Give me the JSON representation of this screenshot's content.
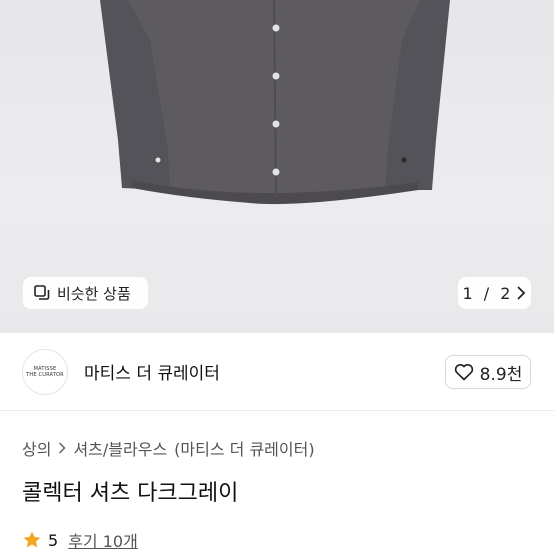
{
  "gallery": {
    "similar_label": "비슷한 상품",
    "page_current": "1",
    "page_total": "2",
    "page_sep": " / "
  },
  "shop": {
    "logo_line1": "MATISSE",
    "logo_line2": "THE CURATOR",
    "name": "마티스 더 큐레이터",
    "like_count": "8.9천"
  },
  "breadcrumb": {
    "level1": "상의",
    "level2": "셔츠/블라우스",
    "level3": "(마티스 더 큐레이터)"
  },
  "product": {
    "title": "콜렉터 셔츠 다크그레이",
    "rating": "5",
    "review_label": "후기 10개"
  },
  "colors": {
    "accent_star": "#f5a623",
    "shirt": "#5a585c"
  }
}
